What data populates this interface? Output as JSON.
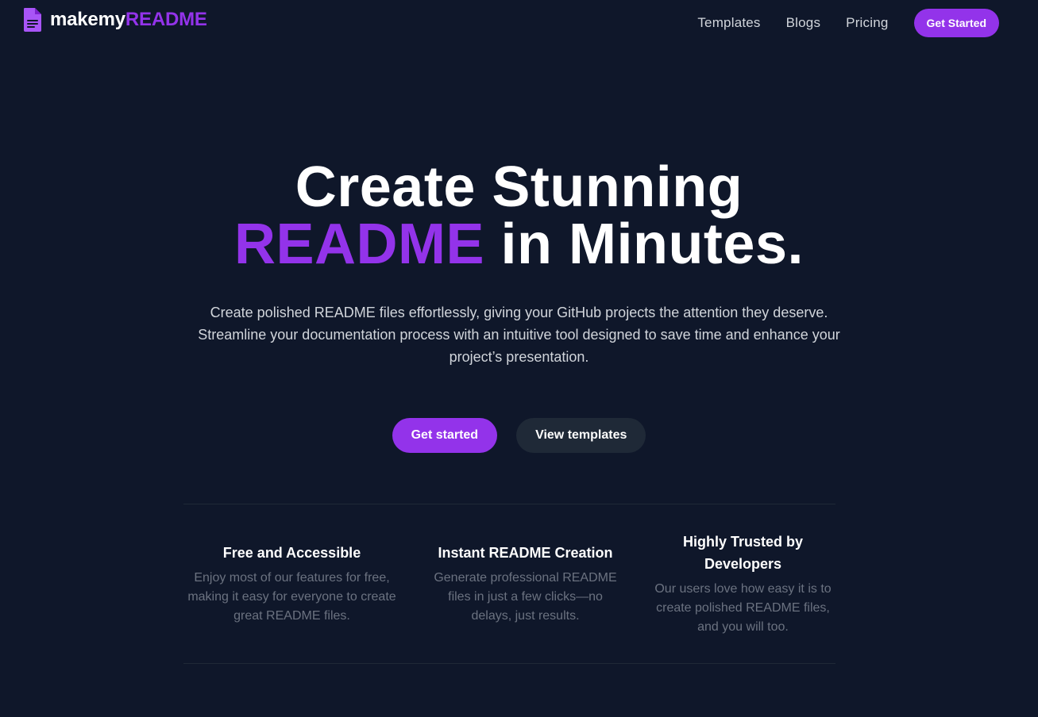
{
  "colors": {
    "background": "#0f172a",
    "accent": "#9333ea",
    "muted_text": "#6b7280",
    "secondary_button": "#1f2937"
  },
  "header": {
    "logo_icon": "document-icon",
    "logo_plain": "makemy",
    "logo_accent": "README",
    "nav": {
      "templates": "Templates",
      "blogs": "Blogs",
      "pricing": "Pricing",
      "get_started": "Get Started"
    }
  },
  "hero": {
    "title_line1": "Create Stunning",
    "title_accent": "README",
    "title_line2_rest": " in Minutes.",
    "description": "Create polished README files effortlessly, giving your GitHub projects the attention they deserve. Streamline your documentation process with an intuitive tool designed to save time and enhance your project’s presentation.",
    "primary_cta": "Get started",
    "secondary_cta": "View templates"
  },
  "features": [
    {
      "title": "Free and Accessible",
      "description": "Enjoy most of our features for free, making it easy for everyone to create great README files."
    },
    {
      "title": "Instant README Creation",
      "description": "Generate professional README files in just a few clicks—no delays, just results."
    },
    {
      "title": "Highly Trusted by Developers",
      "description": "Our users love how easy it is to create polished README files, and you will too."
    }
  ]
}
